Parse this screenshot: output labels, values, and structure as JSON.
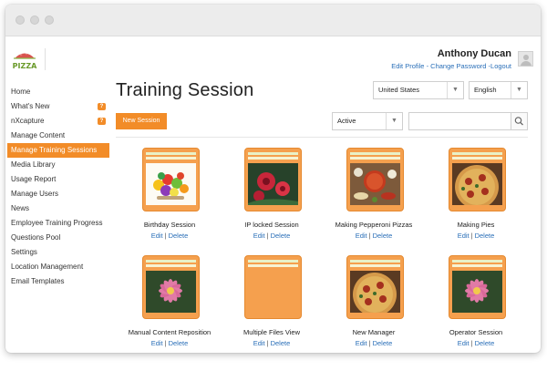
{
  "header": {
    "user_name": "Anthony Ducan",
    "edit_profile": "Edit Profile",
    "sep1": " - ",
    "change_password": "Change Password",
    "sep2": " -",
    "logout": "Logout",
    "logo_text": "PIZZA"
  },
  "sidebar": {
    "items": [
      {
        "label": "Home",
        "badge": ""
      },
      {
        "label": "What's New",
        "badge": "?"
      },
      {
        "label": "nXcapture",
        "badge": "?"
      },
      {
        "label": "Manage Content",
        "badge": ""
      },
      {
        "label": "Manage Training Sessions",
        "badge": ""
      },
      {
        "label": "Media Library",
        "badge": ""
      },
      {
        "label": "Usage Report",
        "badge": ""
      },
      {
        "label": "Manage Users",
        "badge": ""
      },
      {
        "label": "News",
        "badge": ""
      },
      {
        "label": "Employee Training Progress",
        "badge": ""
      },
      {
        "label": "Questions Pool",
        "badge": ""
      },
      {
        "label": "Settings",
        "badge": ""
      },
      {
        "label": "Location Management",
        "badge": ""
      },
      {
        "label": "Email Templates",
        "badge": ""
      }
    ],
    "active_index": 4
  },
  "main": {
    "title": "Training Session",
    "country_select": "United States",
    "language_select": "English",
    "status_select": "Active",
    "new_session_label": "New Session",
    "search_placeholder": "",
    "edit_label": "Edit",
    "delete_label": "Delete",
    "pipe": "|",
    "sessions": [
      {
        "title": "Birthday Session",
        "thumb": "fruit"
      },
      {
        "title": "IP locked Session",
        "thumb": "red-flower"
      },
      {
        "title": "Making Pepperoni Pizzas",
        "thumb": "pizza-ingredients"
      },
      {
        "title": "Making Pies",
        "thumb": "pizza"
      },
      {
        "title": "Manual Content Reposition",
        "thumb": "pink-flower"
      },
      {
        "title": "Multiple Files View",
        "thumb": "none"
      },
      {
        "title": "New Manager",
        "thumb": "pizza"
      },
      {
        "title": "Operator Session",
        "thumb": "pink-flower"
      }
    ]
  },
  "colors": {
    "accent": "#f28c28",
    "link": "#2a6fb8",
    "folder": "#f5a04e"
  }
}
